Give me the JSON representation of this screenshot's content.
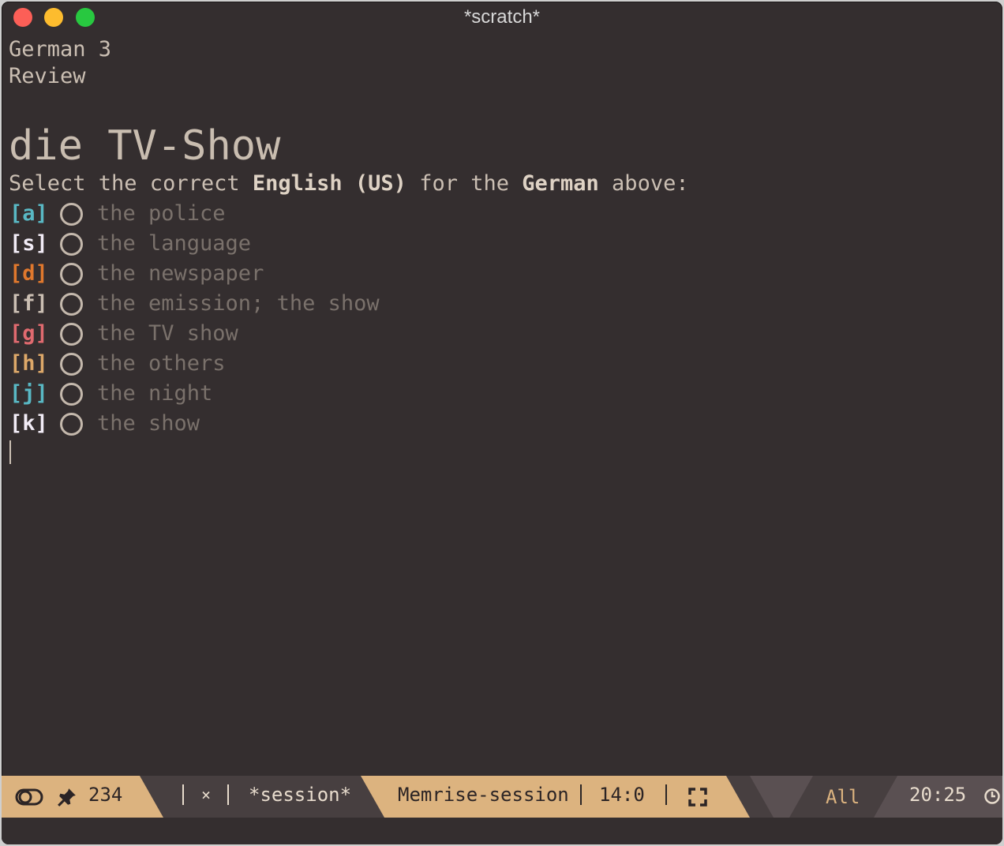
{
  "window": {
    "title": "*scratch*"
  },
  "deck": {
    "course": "German 3",
    "mode": "Review"
  },
  "question": {
    "word": "die TV-Show",
    "prompt_prefix": "Select the correct ",
    "prompt_target": "English (US)",
    "prompt_mid": " for the ",
    "prompt_source": "German",
    "prompt_suffix": " above:"
  },
  "options": [
    {
      "key": "[a]",
      "text": "the police",
      "key_color": "#59b8c4"
    },
    {
      "key": "[s]",
      "text": "the language",
      "key_color": "#f2ecf6"
    },
    {
      "key": "[d]",
      "text": "the newspaper",
      "key_color": "#e0782d"
    },
    {
      "key": "[f]",
      "text": "the emission; the show",
      "key_color": "#cbbfb3"
    },
    {
      "key": "[g]",
      "text": "the TV show",
      "key_color": "#e06a6f"
    },
    {
      "key": "[h]",
      "text": "the others",
      "key_color": "#dda869"
    },
    {
      "key": "[j]",
      "text": "the night",
      "key_color": "#59b8c4"
    },
    {
      "key": "[k]",
      "text": "the show",
      "key_color": "#f2ecf6"
    }
  ],
  "modeline": {
    "count": "234",
    "close_glyph": "×",
    "buffer": "*session*",
    "major_mode": "Memrise-session",
    "position": "14:0",
    "scroll": "All",
    "time": "20:25",
    "accent_color": "#dcb37f",
    "icons": [
      "toggle-icon",
      "pin-icon",
      "fullscreen-icon",
      "clock-icon"
    ]
  }
}
